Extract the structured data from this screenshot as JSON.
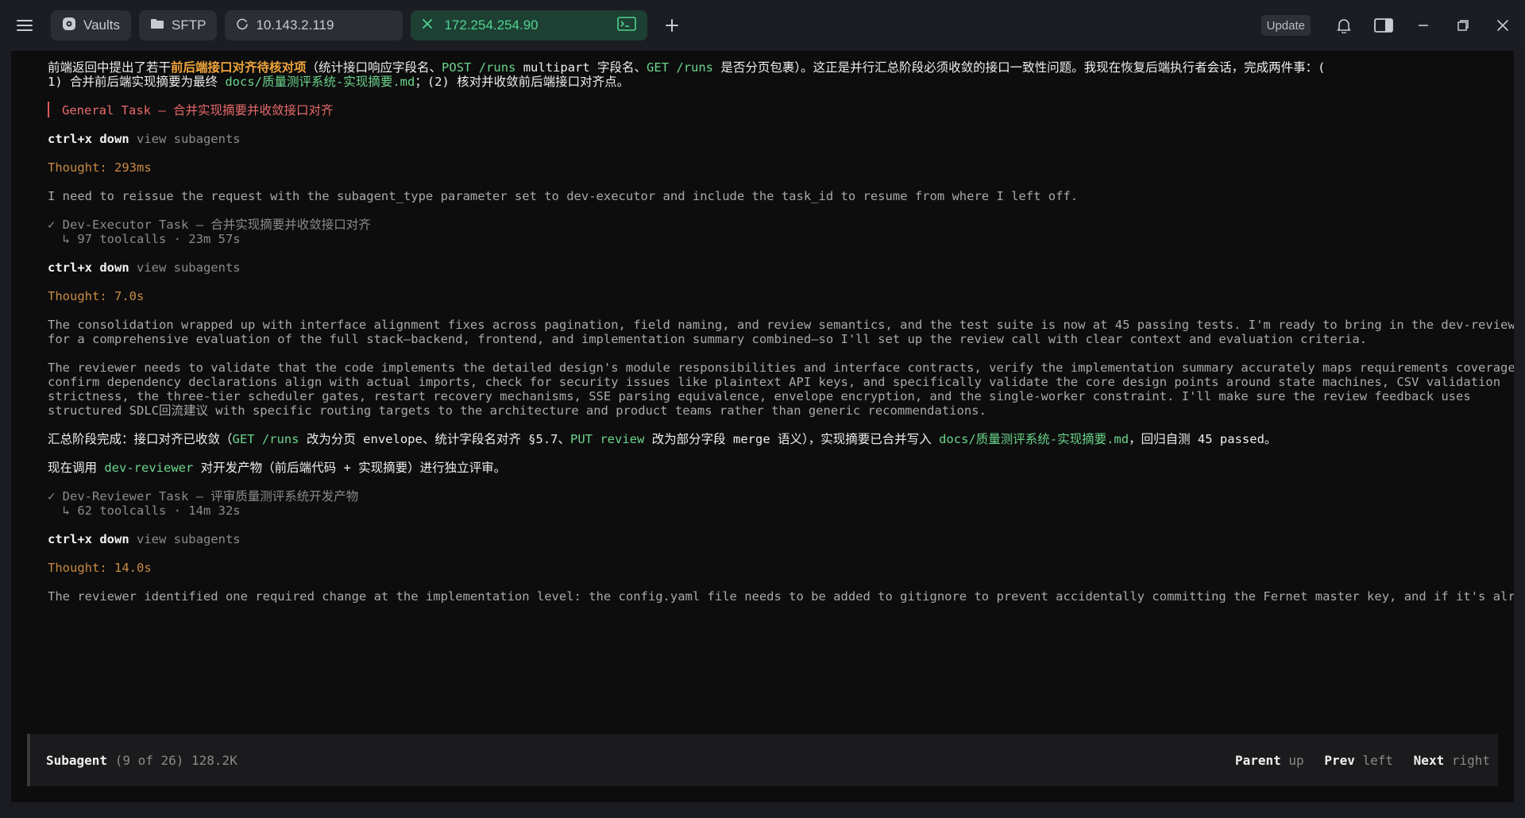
{
  "tabs": [
    {
      "label": "Vaults",
      "icon": "vault-icon"
    },
    {
      "label": "SFTP",
      "icon": "folder-icon"
    },
    {
      "label": "10.143.2.119",
      "icon": "loading-icon"
    },
    {
      "label": "172.254.254.90",
      "icon": "close-icon",
      "trailing_icon": "terminal-icon",
      "active": true
    }
  ],
  "topbar": {
    "update_label": "Update"
  },
  "lines": {
    "l1a": "前端返回中提出了若干",
    "l1b": "前后端接口对齐待核对项",
    "l1c": "（统计接口响应字段名、",
    "l1d": "POST /runs",
    "l1e": " multipart 字段名、",
    "l1f": "GET /runs",
    "l1g": " 是否分页包裹）。这正是并行汇总阶段必须收敛的接口一致性问题。我现在恢复后端执行者会话，完成两件事：(",
    "l2a": "1) 合并前后端实现摘要为最终 ",
    "l2b": "docs/质量测评系统-实现摘要.md",
    "l2c": "；(2) 核对并收敛前后端接口对齐点。",
    "task1": "General Task — 合并实现摘要并收敛接口对齐",
    "ctrl_key": "ctrl+x down",
    "ctrl_desc": " view subagents",
    "thought1": "Thought: 293ms",
    "reissue": "I need to reissue the request with the subagent_type parameter set to dev-executor and include the task_id to resume from where I left off.",
    "exec_task": "✓ Dev-Executor Task — 合并实现摘要并收敛接口对齐",
    "exec_calls": "  ↳ 97 toolcalls · 23m 57s",
    "thought2": "Thought: 7.0s",
    "cons1": "The consolidation wrapped up with interface alignment fixes across pagination, field naming, and review semantics, and the test suite is now at 45 passing tests. I'm ready to bring in the dev-reviewer",
    "cons2": "for a comprehensive evaluation of the full stack—backend, frontend, and implementation summary combined—so I'll set up the review call with clear context and evaluation criteria.",
    "rev1": "The reviewer needs to validate that the code implements the detailed design's module responsibilities and interface contracts, verify the implementation summary accurately maps requirements coverage,",
    "rev2": "confirm dependency declarations align with actual imports, check for security issues like plaintext API keys, and specifically validate the core design points around state machines, CSV validation",
    "rev3": "strictness, the three-tier scheduler gates, restart recovery mechanisms, SSE parsing equivalence, envelope encryption, and the single-worker constraint. I'll make sure the review feedback uses",
    "rev4": "structured SDLC回流建议 with specific routing targets to the architecture and product teams rather than generic recommendations.",
    "sum_a": "汇总阶段完成：接口对齐已收敛（",
    "sum_b": "GET /runs",
    "sum_c": " 改为分页 envelope、统计字段名对齐 §5.7、",
    "sum_d": "PUT review",
    "sum_e": " 改为部分字段 merge 语义），实现摘要已合并写入 ",
    "sum_f": "docs/质量测评系统-实现摘要.md",
    "sum_g": "，回归自测 45 passed。",
    "call_a": "现在调用 ",
    "call_b": "dev-reviewer",
    "call_c": " 对开发产物（前后端代码 + 实现摘要）进行独立评审。",
    "rev_task": "✓ Dev-Reviewer Task — 评审质量测评系统开发产物",
    "rev_calls": "  ↳ 62 toolcalls · 14m 32s",
    "thought3": "Thought: 14.0s",
    "final": "The reviewer identified one required change at the implementation level: the config.yaml file needs to be added to gitignore to prevent accidentally committing the Fernet master key, and if it's already"
  },
  "subagent": {
    "label": "Subagent",
    "info": " (9 of 26) 128.2K",
    "parent": "Parent",
    "parent_key": " up",
    "prev": "Prev",
    "prev_key": " left",
    "next": "Next",
    "next_key": " right"
  },
  "colors": {
    "background": "#0d0d0e",
    "active_tab": "#1e3f33",
    "active_tab_text": "#4fd38f",
    "green_code": "#6bd58a",
    "orange_highlight": "#f0a53b",
    "thought": "#c98a43",
    "task_red": "#e86a6a"
  }
}
